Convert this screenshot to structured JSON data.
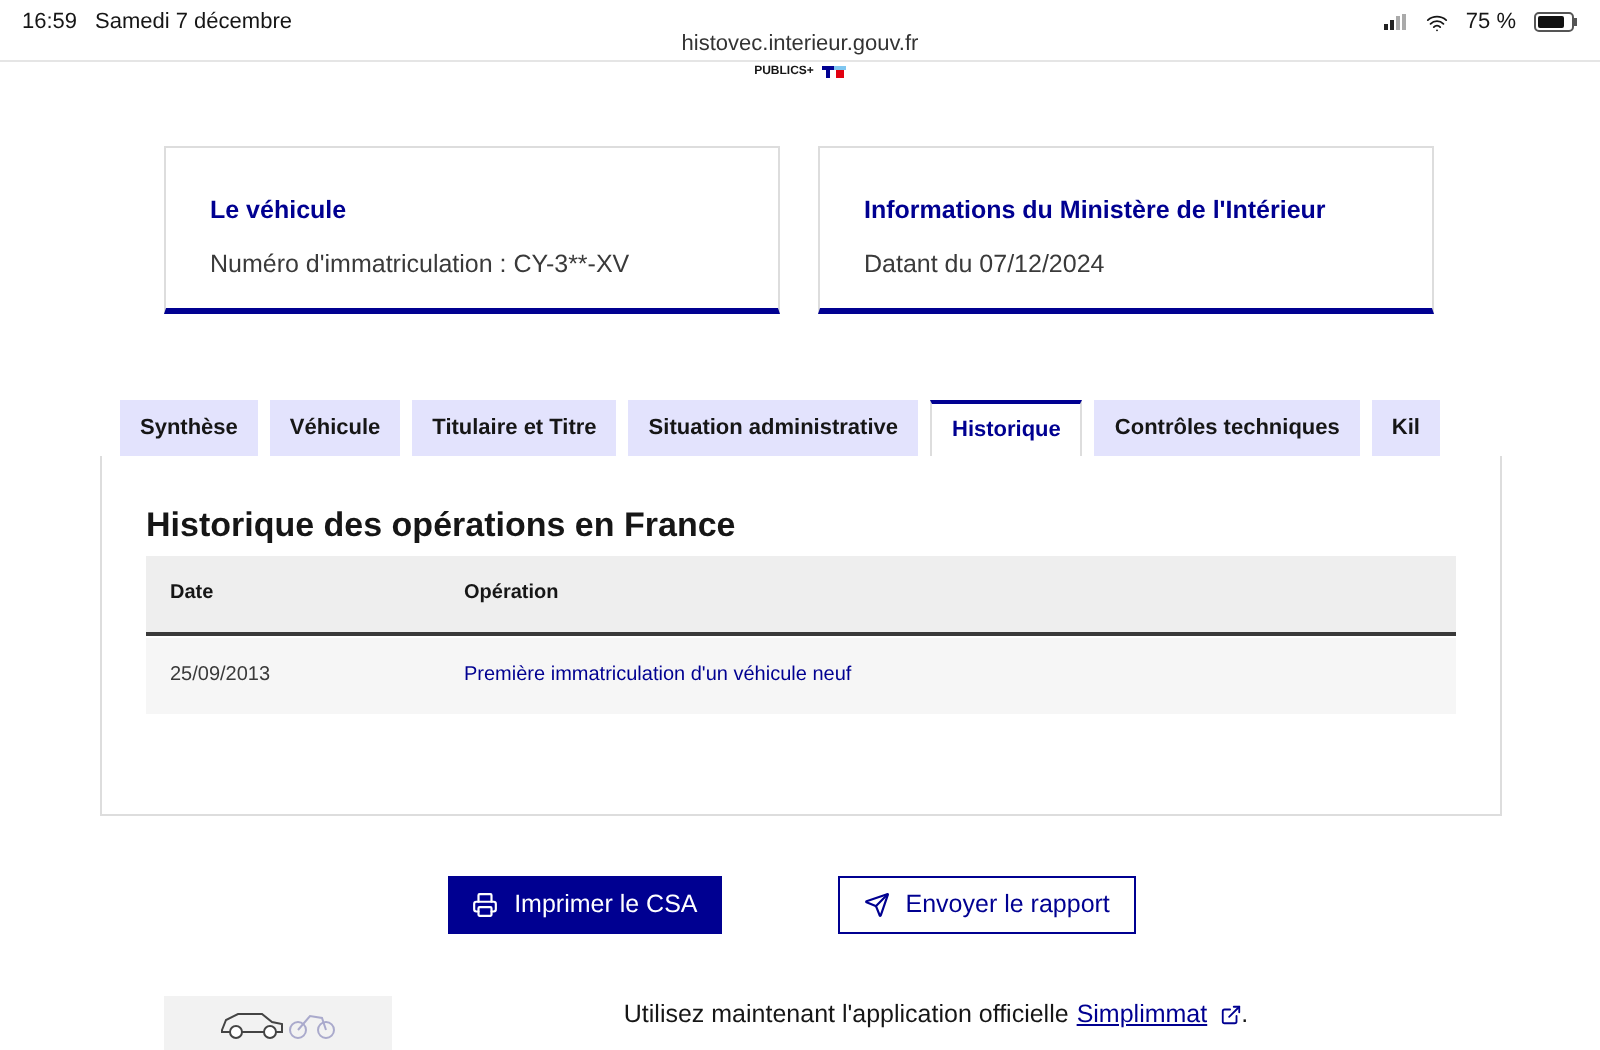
{
  "status_bar": {
    "time": "16:59",
    "date": "Samedi 7 décembre",
    "url": "histovec.interieur.gouv.fr",
    "battery": "75 %"
  },
  "header": {
    "logo_text": "PUBLICS+"
  },
  "cards": [
    {
      "title": "Le véhicule",
      "text": "Numéro d'immatriculation : CY-3**-XV"
    },
    {
      "title": "Informations du Ministère de l'Intérieur",
      "text": "Datant du 07/12/2024"
    }
  ],
  "tabs": [
    {
      "label": "Synthèse",
      "selected": false
    },
    {
      "label": "Véhicule",
      "selected": false
    },
    {
      "label": "Titulaire et Titre",
      "selected": false
    },
    {
      "label": "Situation administrative",
      "selected": false
    },
    {
      "label": "Historique",
      "selected": true
    },
    {
      "label": "Contrôles techniques",
      "selected": false
    },
    {
      "label": "Kil",
      "selected": false
    }
  ],
  "panel": {
    "title": "Historique des opérations en France",
    "table": {
      "columns": [
        "Date",
        "Opération"
      ],
      "rows": [
        [
          "25/09/2013",
          "Première immatriculation d'un véhicule neuf"
        ]
      ]
    }
  },
  "buttons": [
    {
      "label": "Imprimer le CSA",
      "kind": "primary"
    },
    {
      "label": "Envoyer le rapport",
      "kind": "secondary"
    }
  ],
  "promo": {
    "text_before": "Utilisez maintenant l'application officielle",
    "link": "Simplimmat",
    "text_after": "."
  }
}
